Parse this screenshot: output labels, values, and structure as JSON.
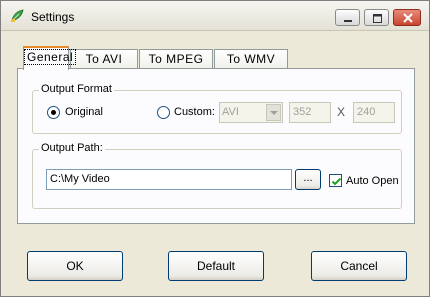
{
  "window": {
    "title": "Settings",
    "icon": "green-leaf-settings-icon",
    "controls": [
      "minimize-icon",
      "maximize-icon",
      "close-icon"
    ]
  },
  "tabs": [
    {
      "label": "General",
      "active": true
    },
    {
      "label": "To AVI",
      "active": false
    },
    {
      "label": "To MPEG",
      "active": false
    },
    {
      "label": "To WMV",
      "active": false
    }
  ],
  "general": {
    "output_format": {
      "label": "Output Format",
      "original_label": "Original",
      "original_selected": true,
      "custom_label": "Custom:",
      "custom_selected": false,
      "format_value": "AVI",
      "width_value": "352",
      "times_label": "X",
      "height_value": "240"
    },
    "output_path": {
      "label": "Output Path:",
      "path_value": "C:\\My Video",
      "browse_label": "...",
      "auto_open_label": "Auto Open",
      "auto_open_checked": true
    }
  },
  "footer": {
    "ok_label": "OK",
    "default_label": "Default",
    "cancel_label": "Cancel"
  },
  "colors": {
    "dialog_bg": "#ece9d8",
    "tab_active_accent": "#e68b2c",
    "close_button": "#c8452f"
  }
}
